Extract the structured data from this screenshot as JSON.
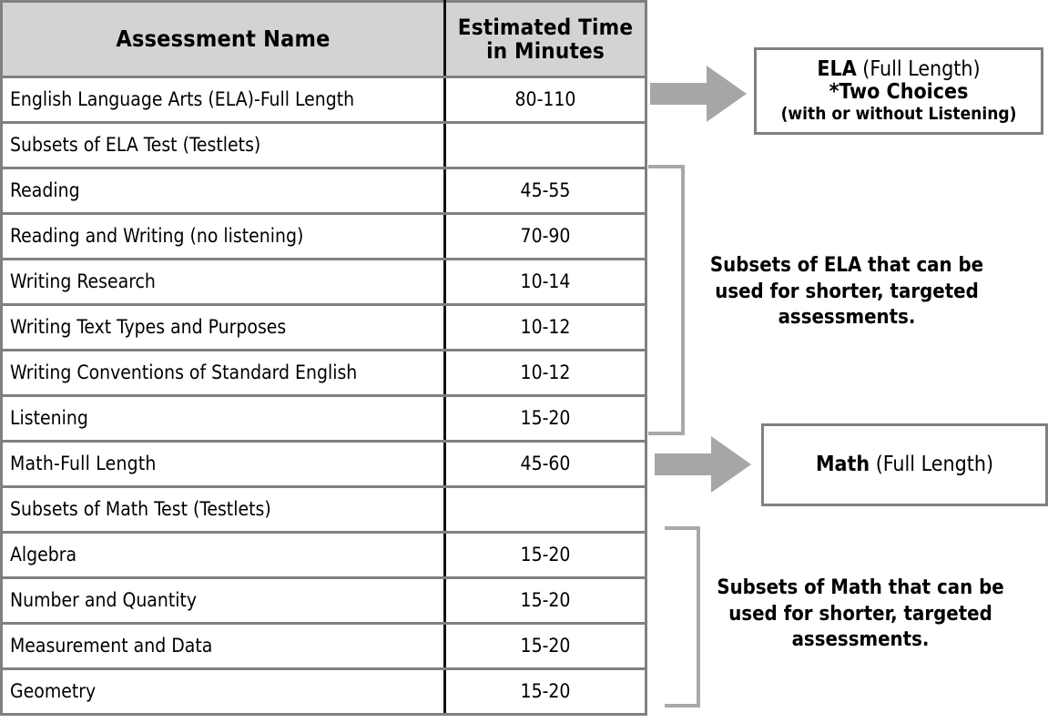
{
  "table": {
    "columns": [
      "Assessment Name",
      "Estimated Time in Minutes"
    ],
    "header": {
      "name": "Assessment Name",
      "time_line1": "Estimated Time",
      "time_line2": "in Minutes"
    },
    "rows": [
      {
        "name": "English Language Arts (ELA)-Full Length",
        "time": "80-110",
        "style": "bold-left"
      },
      {
        "name": "Subsets of ELA Test (Testlets)",
        "time": "",
        "style": "center"
      },
      {
        "name": "Reading",
        "time": "45-55",
        "style": "normal"
      },
      {
        "name": "Reading and Writing (no listening)",
        "time": "70-90",
        "style": "normal"
      },
      {
        "name": "Writing Research",
        "time": "10-14",
        "style": "normal"
      },
      {
        "name": "Writing Text Types and Purposes",
        "time": "10-12",
        "style": "normal"
      },
      {
        "name": "Writing Conventions of Standard English",
        "time": "10-12",
        "style": "normal"
      },
      {
        "name": "Listening",
        "time": "15-20",
        "style": "normal"
      },
      {
        "name": "Math-Full Length",
        "time": "45-60",
        "style": "center-bold"
      },
      {
        "name": "Subsets of Math Test (Testlets)",
        "time": "",
        "style": "center"
      },
      {
        "name": "Algebra",
        "time": "15-20",
        "style": "normal"
      },
      {
        "name": "Number and Quantity",
        "time": "15-20",
        "style": "normal"
      },
      {
        "name": "Measurement and Data",
        "time": "15-20",
        "style": "normal"
      },
      {
        "name": "Geometry",
        "time": "15-20",
        "style": "normal"
      }
    ]
  },
  "callouts": {
    "ela": {
      "line1_bold": "ELA",
      "line1_rest": " (Full Length)",
      "line2": "*Two Choices",
      "line3": "(with or without Listening)"
    },
    "math": {
      "line1_bold": "Math",
      "line1_rest": " (Full Length)"
    }
  },
  "notes": {
    "ela_subsets": "Subsets of ELA that can be used for shorter, targeted assessments.",
    "math_subsets": "Subsets of Math that can be used for shorter, targeted assessments."
  },
  "icons": {
    "ela_arrow": "right-arrow-icon",
    "math_arrow": "right-arrow-icon",
    "ela_bracket": "right-brace-icon",
    "math_bracket": "right-brace-icon"
  },
  "colors": {
    "header_fill": "#d3d3d3",
    "border_gray": "#808080",
    "arrow_gray": "#a6a6a6",
    "bracket_gray": "#a8a8a8",
    "text": "#000000"
  }
}
